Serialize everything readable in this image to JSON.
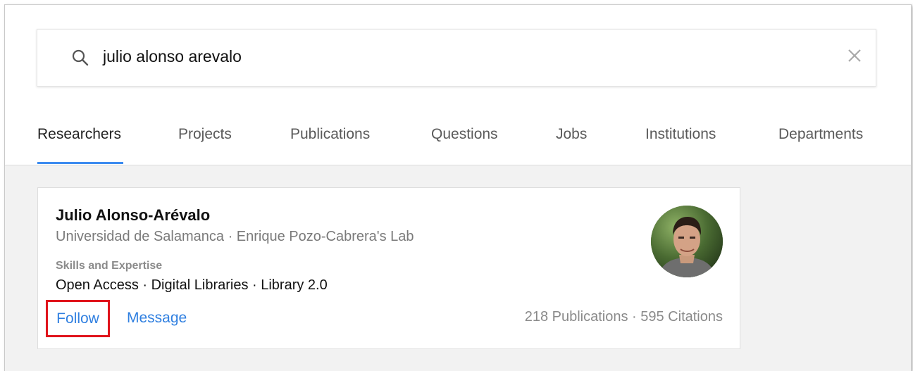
{
  "search": {
    "query": "julio alonso arevalo"
  },
  "tabs": [
    {
      "label": "Researchers",
      "active": true
    },
    {
      "label": "Projects",
      "active": false
    },
    {
      "label": "Publications",
      "active": false
    },
    {
      "label": "Questions",
      "active": false
    },
    {
      "label": "Jobs",
      "active": false
    },
    {
      "label": "Institutions",
      "active": false
    },
    {
      "label": "Departments",
      "active": false
    }
  ],
  "result": {
    "name": "Julio Alonso-Arévalo",
    "affiliation": "Universidad de Salamanca · Enrique Pozo-Cabrera's Lab",
    "skills_label": "Skills and Expertise",
    "skills": "Open Access · Digital Libraries · Library 2.0",
    "follow_label": "Follow",
    "message_label": "Message",
    "stats": "218 Publications · 595 Citations"
  },
  "icons": {
    "search": "search-icon",
    "clear": "close-icon",
    "avatar": "avatar"
  },
  "colors": {
    "accent": "#3d8cf0",
    "link": "#2f7fe0",
    "highlight": "#e0141c",
    "background": "#f2f2f2"
  }
}
